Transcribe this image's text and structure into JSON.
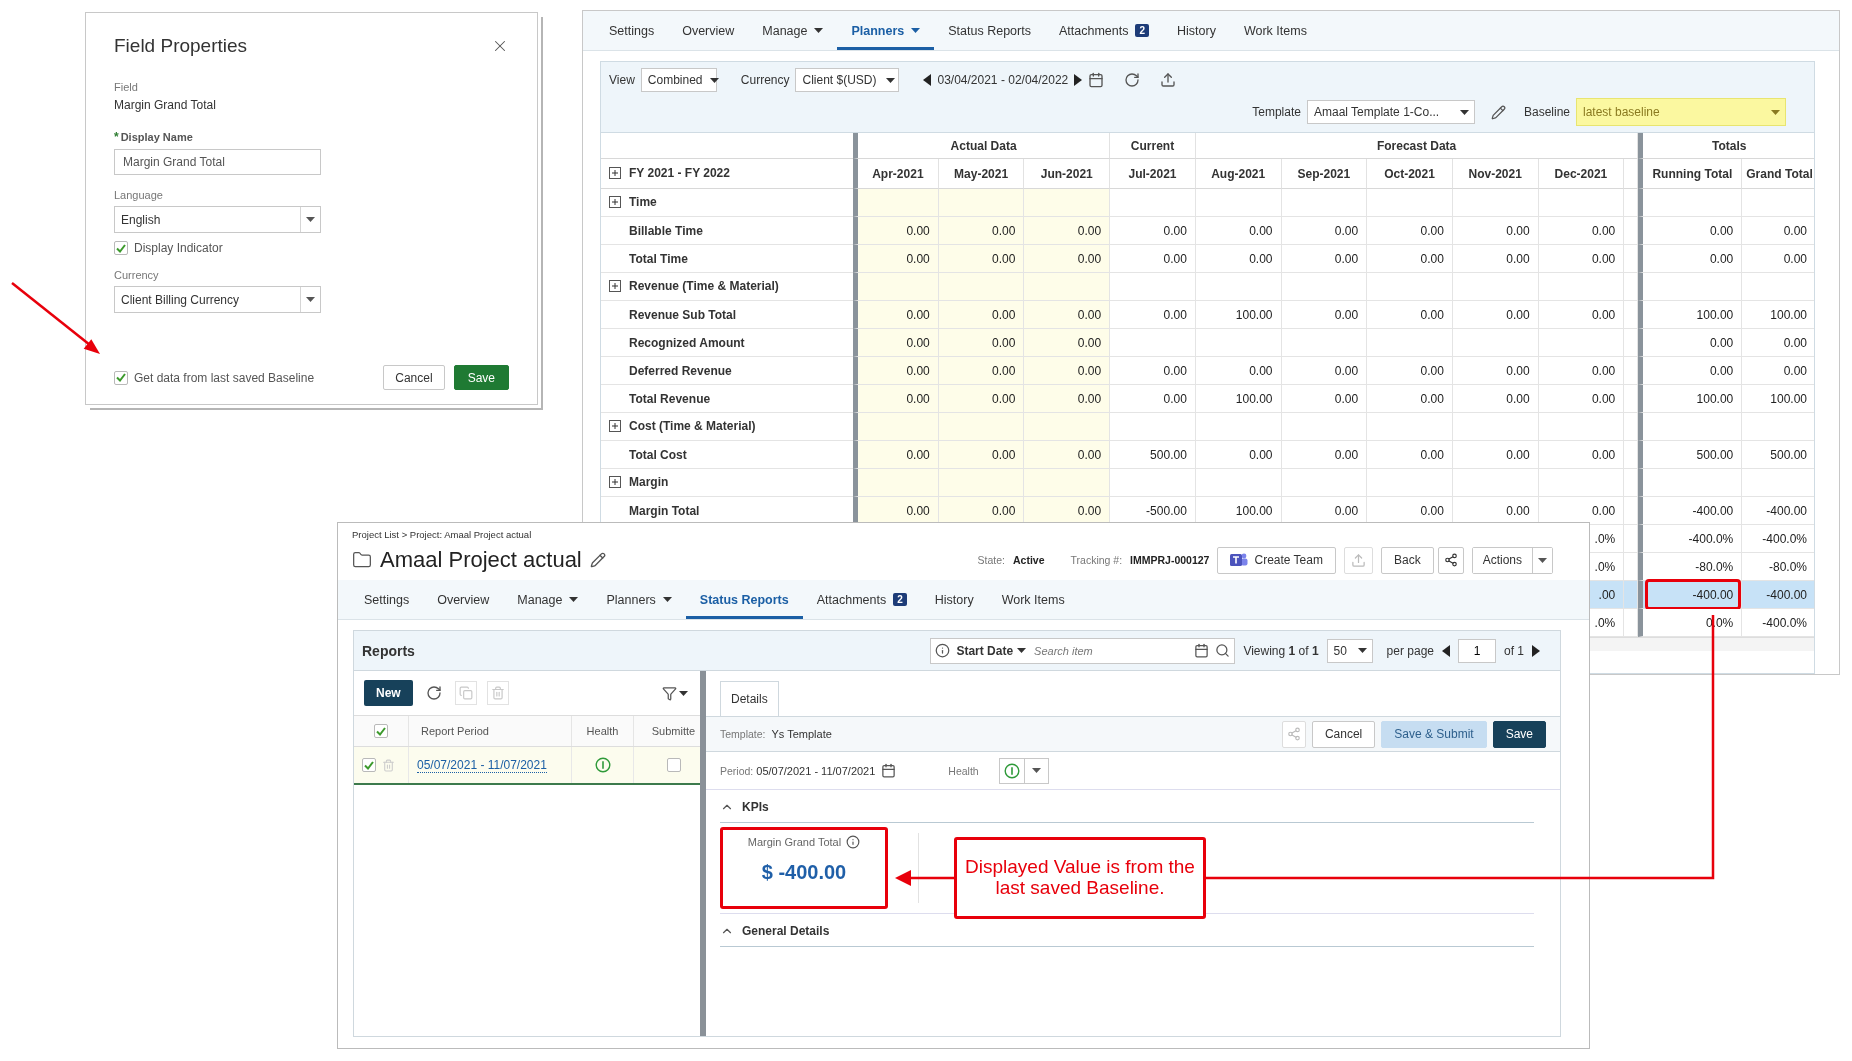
{
  "dialog": {
    "title": "Field Properties",
    "field_label": "Field",
    "field_value": "Margin Grand Total",
    "display_name": {
      "required_mark": "*",
      "label": "Display Name",
      "value": "Margin Grand Total"
    },
    "language": {
      "label": "Language",
      "value": "English"
    },
    "display_indicator": {
      "label": "Display Indicator",
      "checked": true
    },
    "currency": {
      "label": "Currency",
      "value": "Client Billing Currency"
    },
    "baseline_option": {
      "label": "Get data from last saved Baseline",
      "checked": true
    },
    "buttons": [
      {
        "label": "Cancel",
        "kind": "secondary"
      },
      {
        "label": "Save",
        "kind": "primary"
      }
    ]
  },
  "planner": {
    "tabs": [
      {
        "label": "Settings",
        "selected": false
      },
      {
        "label": "Overview",
        "selected": false
      },
      {
        "label": "Manage",
        "dropdown": true,
        "selected": false
      },
      {
        "label": "Planners",
        "dropdown": true,
        "selected": true
      },
      {
        "label": "Status Reports",
        "selected": false
      },
      {
        "label": "Attachments",
        "badge": "2",
        "selected": false
      },
      {
        "label": "History",
        "selected": false
      },
      {
        "label": "Work Items",
        "selected": false
      }
    ],
    "toolbar": {
      "view_label": "View",
      "view": "Combined",
      "currency_label": "Currency",
      "currency": "Client $(USD)",
      "date_range": "03/04/2021 - 02/04/2022",
      "template_label": "Template",
      "template": "Amaal Template 1-Co...",
      "baseline_label": "Baseline",
      "baseline": "latest baseline"
    },
    "table": {
      "period": "FY 2021 - FY 2022",
      "groups": [
        {
          "label": "Actual Data",
          "kind": "actual",
          "columns": [
            "Apr-2021",
            "May-2021",
            "Jun-2021"
          ]
        },
        {
          "label": "Current",
          "kind": "current",
          "columns": [
            "Jul-2021"
          ]
        },
        {
          "label": "Forecast Data",
          "kind": "forecast",
          "columns": [
            "Aug-2021",
            "Sep-2021",
            "Oct-2021",
            "Nov-2021",
            "Dec-2021"
          ]
        },
        {
          "label": "Totals",
          "kind": "totals",
          "columns": [
            "Running Total",
            "Grand Total"
          ]
        }
      ],
      "rows": [
        {
          "label": "Time",
          "kind": "group",
          "selected": false
        },
        {
          "label": "Billable Time",
          "kind": "item",
          "selected": false,
          "cells": {
            "actual": [
              "0.00",
              "0.00",
              "0.00"
            ],
            "current": [
              "0.00"
            ],
            "forecast": [
              "0.00",
              "0.00",
              "0.00",
              "0.00",
              "0.00"
            ],
            "totals": [
              "0.00",
              "0.00"
            ]
          }
        },
        {
          "label": "Total Time",
          "kind": "item",
          "selected": false,
          "cells": {
            "actual": [
              "0.00",
              "0.00",
              "0.00"
            ],
            "current": [
              "0.00"
            ],
            "forecast": [
              "0.00",
              "0.00",
              "0.00",
              "0.00",
              "0.00"
            ],
            "totals": [
              "0.00",
              "0.00"
            ]
          }
        },
        {
          "label": "Revenue (Time & Material)",
          "kind": "group",
          "selected": false
        },
        {
          "label": "Revenue Sub Total",
          "kind": "item",
          "selected": false,
          "cells": {
            "actual": [
              "0.00",
              "0.00",
              "0.00"
            ],
            "current": [
              "0.00"
            ],
            "forecast": [
              "100.00",
              "0.00",
              "0.00",
              "0.00",
              "0.00"
            ],
            "totals": [
              "100.00",
              "100.00"
            ]
          }
        },
        {
          "label": "Recognized Amount",
          "kind": "item",
          "selected": false,
          "cells": {
            "actual": [
              "0.00",
              "0.00",
              "0.00"
            ],
            "totals": [
              "0.00",
              "0.00"
            ]
          }
        },
        {
          "label": "Deferred Revenue",
          "kind": "item",
          "selected": false,
          "cells": {
            "actual": [
              "0.00",
              "0.00",
              "0.00"
            ],
            "current": [
              "0.00"
            ],
            "forecast": [
              "0.00",
              "0.00",
              "0.00",
              "0.00",
              "0.00"
            ],
            "totals": [
              "0.00",
              "0.00"
            ]
          }
        },
        {
          "label": "Total Revenue",
          "kind": "item",
          "selected": false,
          "cells": {
            "actual": [
              "0.00",
              "0.00",
              "0.00"
            ],
            "current": [
              "0.00"
            ],
            "forecast": [
              "100.00",
              "0.00",
              "0.00",
              "0.00",
              "0.00"
            ],
            "totals": [
              "100.00",
              "100.00"
            ]
          }
        },
        {
          "label": "Cost (Time & Material)",
          "kind": "group",
          "selected": false
        },
        {
          "label": "Total Cost",
          "kind": "item",
          "selected": false,
          "cells": {
            "actual": [
              "0.00",
              "0.00",
              "0.00"
            ],
            "current": [
              "500.00"
            ],
            "forecast": [
              "0.00",
              "0.00",
              "0.00",
              "0.00",
              "0.00"
            ],
            "totals": [
              "500.00",
              "500.00"
            ]
          }
        },
        {
          "label": "Margin",
          "kind": "group",
          "selected": false
        },
        {
          "label": "Margin Total",
          "kind": "item",
          "selected": false,
          "cells": {
            "actual": [
              "0.00",
              "0.00",
              "0.00"
            ],
            "current": [
              "-500.00"
            ],
            "forecast": [
              "100.00",
              "0.00",
              "0.00",
              "0.00",
              "0.00"
            ],
            "totals": [
              "-400.00",
              "-400.00"
            ]
          }
        },
        {
          "kind": "item",
          "selected": false,
          "cells": {
            "forecast": [
              ".0%"
            ],
            "totals": [
              "-400.0%",
              "-400.0%"
            ]
          }
        },
        {
          "kind": "item",
          "selected": false,
          "cells": {
            "forecast": [
              ".0%"
            ],
            "totals": [
              "-80.0%",
              "-80.0%"
            ]
          }
        },
        {
          "kind": "item",
          "selected": true,
          "framed": true,
          "cells": {
            "forecast": [
              ".00"
            ],
            "totals": [
              "-400.00",
              "-400.00"
            ]
          }
        },
        {
          "kind": "item",
          "selected": false,
          "cells": {
            "forecast": [
              ".0%"
            ],
            "totals": [
              "0.0%",
              "-400.0%"
            ]
          }
        }
      ]
    }
  },
  "project": {
    "breadcrumb": "Project List > Project: Amaal Project actual",
    "title": "Amaal Project actual",
    "state_label": "State:",
    "state": "Active",
    "tracking_label": "Tracking #:",
    "tracking": "IMMPRJ-000127",
    "create_team": "Create Team",
    "back": "Back",
    "actions": "Actions",
    "tabs": [
      {
        "label": "Settings",
        "selected": false
      },
      {
        "label": "Overview",
        "selected": false
      },
      {
        "label": "Manage",
        "dropdown": true,
        "selected": false
      },
      {
        "label": "Planners",
        "dropdown": true,
        "selected": false
      },
      {
        "label": "Status Reports",
        "selected": true
      },
      {
        "label": "Attachments",
        "badge": "2",
        "selected": false
      },
      {
        "label": "History",
        "selected": false
      },
      {
        "label": "Work Items",
        "selected": false
      }
    ],
    "reports": {
      "title": "Reports",
      "sort": "Start Date",
      "search_placeholder": "Search item",
      "viewing": "Viewing **1** of **1**",
      "page_size": "50",
      "per_page": "per page",
      "page": "1",
      "page_of": "of 1",
      "new_button": "New",
      "header_checked": true,
      "columns": [
        "Report Period",
        "Health",
        "Submitte"
      ],
      "rows": [
        {
          "period": "05/07/2021 - 11/07/2021",
          "checked": true,
          "selected": true,
          "submitted": false
        }
      ]
    },
    "details": {
      "tab": "Details",
      "template_label": "Template:",
      "template": "Ys Template",
      "buttons": [
        {
          "label": "Cancel",
          "kind": "secondary"
        },
        {
          "label": "Save & Submit",
          "kind": "light"
        },
        {
          "label": "Save",
          "kind": "primary"
        }
      ],
      "period_label": "Period:",
      "period": "05/07/2021 - 11/07/2021",
      "health_label": "Health",
      "sections": [
        {
          "title": "KPIs",
          "expanded": true,
          "kpis": [
            {
              "label": "Margin Grand Total",
              "value": "$ -400.00",
              "framed": true
            }
          ]
        },
        {
          "title": "General Details",
          "expanded": true
        }
      ]
    }
  },
  "annotation": {
    "callout": "Displayed Value is from the last saved Baseline."
  }
}
